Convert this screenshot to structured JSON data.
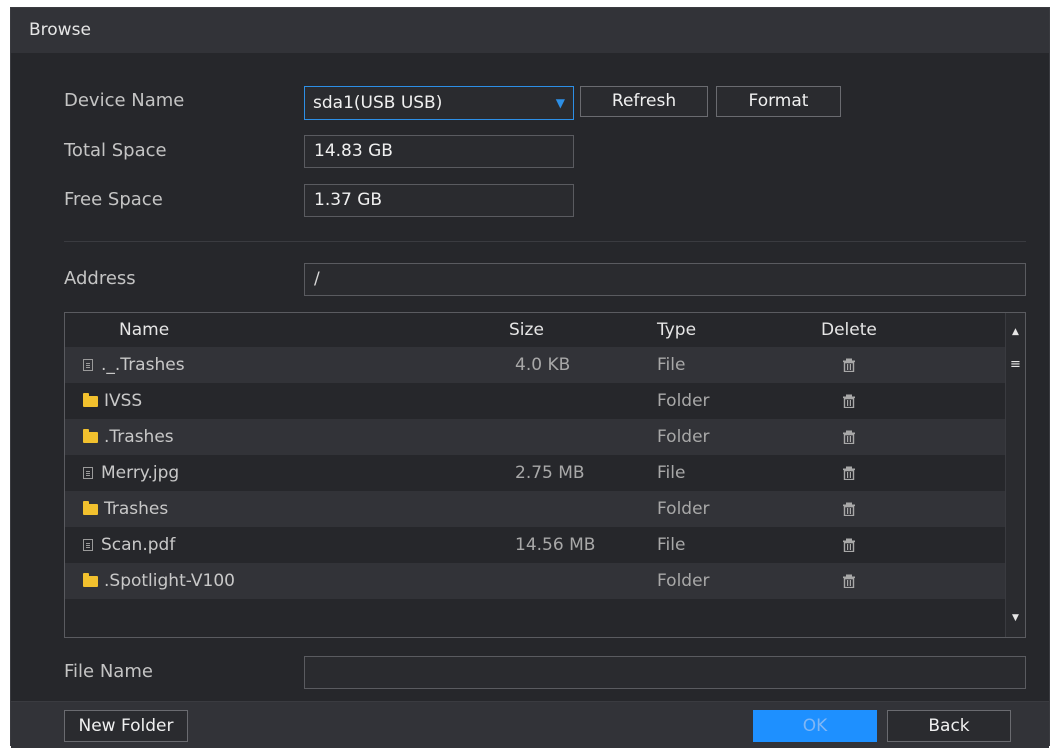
{
  "dialog": {
    "title": "Browse"
  },
  "device": {
    "name_label": "Device Name",
    "name_value": "sda1(USB USB)",
    "refresh_label": "Refresh",
    "format_label": "Format",
    "total_label": "Total Space",
    "total_value": "14.83 GB",
    "free_label": "Free Space",
    "free_value": "1.37 GB"
  },
  "address": {
    "label": "Address",
    "value": "/"
  },
  "table": {
    "headers": {
      "name": "Name",
      "size": "Size",
      "type": "Type",
      "delete": "Delete"
    },
    "rows": [
      {
        "icon": "file-icon",
        "name": "._.Trashes",
        "size": "4.0 KB",
        "type": "File"
      },
      {
        "icon": "folder-icon",
        "name": "IVSS",
        "size": "",
        "type": "Folder"
      },
      {
        "icon": "folder-icon",
        "name": ".Trashes",
        "size": "",
        "type": "Folder"
      },
      {
        "icon": "file-icon",
        "name": "Merry.jpg",
        "size": "2.75 MB",
        "type": "File"
      },
      {
        "icon": "folder-icon",
        "name": "Trashes",
        "size": "",
        "type": "Folder"
      },
      {
        "icon": "file-icon",
        "name": "Scan.pdf",
        "size": "14.56 MB",
        "type": "File"
      },
      {
        "icon": "folder-icon",
        "name": ".Spotlight-V100",
        "size": "",
        "type": "Folder"
      }
    ]
  },
  "filename": {
    "label": "File Name",
    "value": ""
  },
  "footer": {
    "new_folder_label": "New Folder",
    "ok_label": "OK",
    "back_label": "Back"
  },
  "colors": {
    "accent": "#1e90ff",
    "folder": "#f2c12e"
  }
}
